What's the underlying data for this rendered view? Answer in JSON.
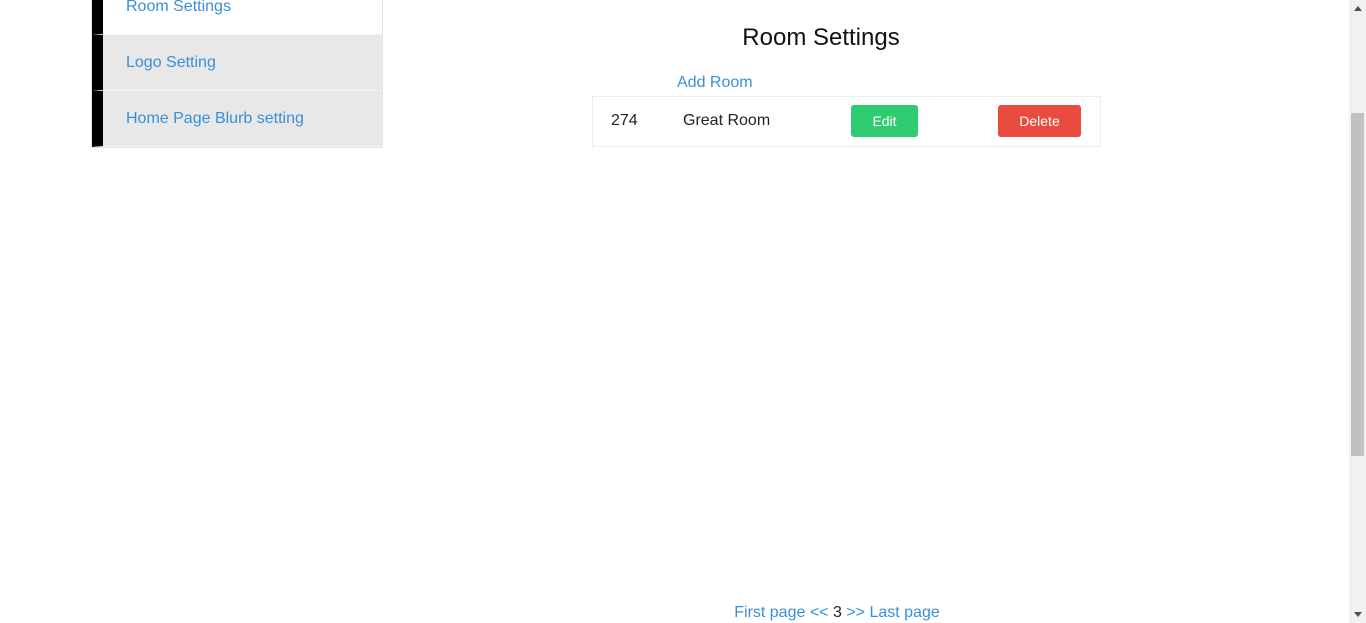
{
  "sidebar": {
    "items": [
      {
        "label": "Room Settings",
        "active": true
      },
      {
        "label": "Logo Setting",
        "active": false
      },
      {
        "label": "Home Page Blurb setting",
        "active": false
      }
    ]
  },
  "main": {
    "title": "Room Settings",
    "add_room_label": "Add Room",
    "rooms": [
      {
        "id": "274",
        "name": "Great Room",
        "edit_label": "Edit",
        "delete_label": "Delete"
      }
    ]
  },
  "pagination": {
    "first_label": "First page",
    "prev_label": "<<",
    "current_page": "3",
    "next_label": ">>",
    "last_label": "Last page"
  },
  "colors": {
    "link": "#3a8fd6",
    "edit_button": "#2ecc71",
    "delete_button": "#e74c3c",
    "sidebar_accent": "#000000",
    "sidebar_inactive_bg": "#e8e8e8"
  },
  "icons": {
    "scroll_up": "triangle-up-icon",
    "scroll_down": "triangle-down-icon"
  }
}
